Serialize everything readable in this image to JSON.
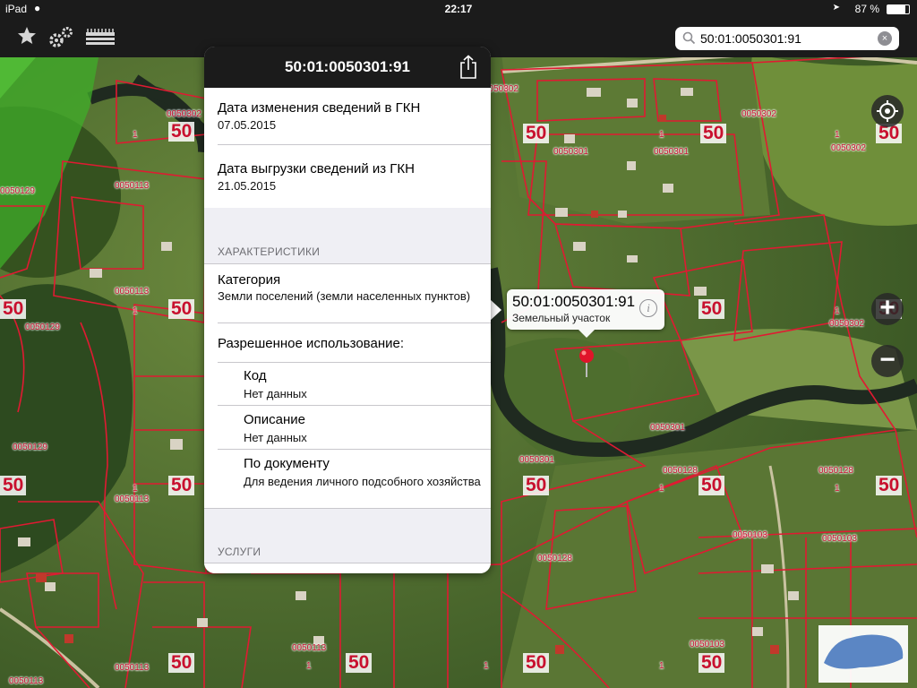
{
  "status_bar": {
    "device": "iPad",
    "time": "22:17",
    "battery": "87 %"
  },
  "search": {
    "value": "50:01:0050301:91",
    "placeholder": "",
    "clear": "×"
  },
  "popover": {
    "title": "50:01:0050301:91",
    "rows": {
      "change_date_label": "Дата изменения сведений в ГКН",
      "change_date_value": "07.05.2015",
      "export_date_label": "Дата выгрузки сведений из ГКН",
      "export_date_value": "21.05.2015"
    },
    "section_characteristics": "ХАРАКТЕРИСТИКИ",
    "category_label": "Категория",
    "category_value": "Земли поселений (земли населенных пунктов)",
    "permitted_use_label": "Разрешенное использование:",
    "code_label": "Код",
    "code_value": "Нет данных",
    "description_label": "Описание",
    "description_value": "Нет данных",
    "by_document_label": "По документу",
    "by_document_value": "Для ведения личного подсобного хозяйства",
    "section_services": "УСЛУГИ"
  },
  "callout": {
    "title": "50:01:0050301:91",
    "subtitle": "Земельный участок",
    "info": "i"
  },
  "map_controls": {
    "zoom_in": "+",
    "zoom_out": "−"
  },
  "map": {
    "quarter_codes": [
      "0050302",
      "0050113",
      "0050129",
      "0050301",
      "0050128",
      "0050103"
    ],
    "district_label": "50",
    "block_label": "1"
  },
  "colors": {
    "toolbar": "#1b1b1b",
    "parcel_border": "#d0102c",
    "accent_green": "#3fae2a",
    "pin": "#e0142a"
  }
}
